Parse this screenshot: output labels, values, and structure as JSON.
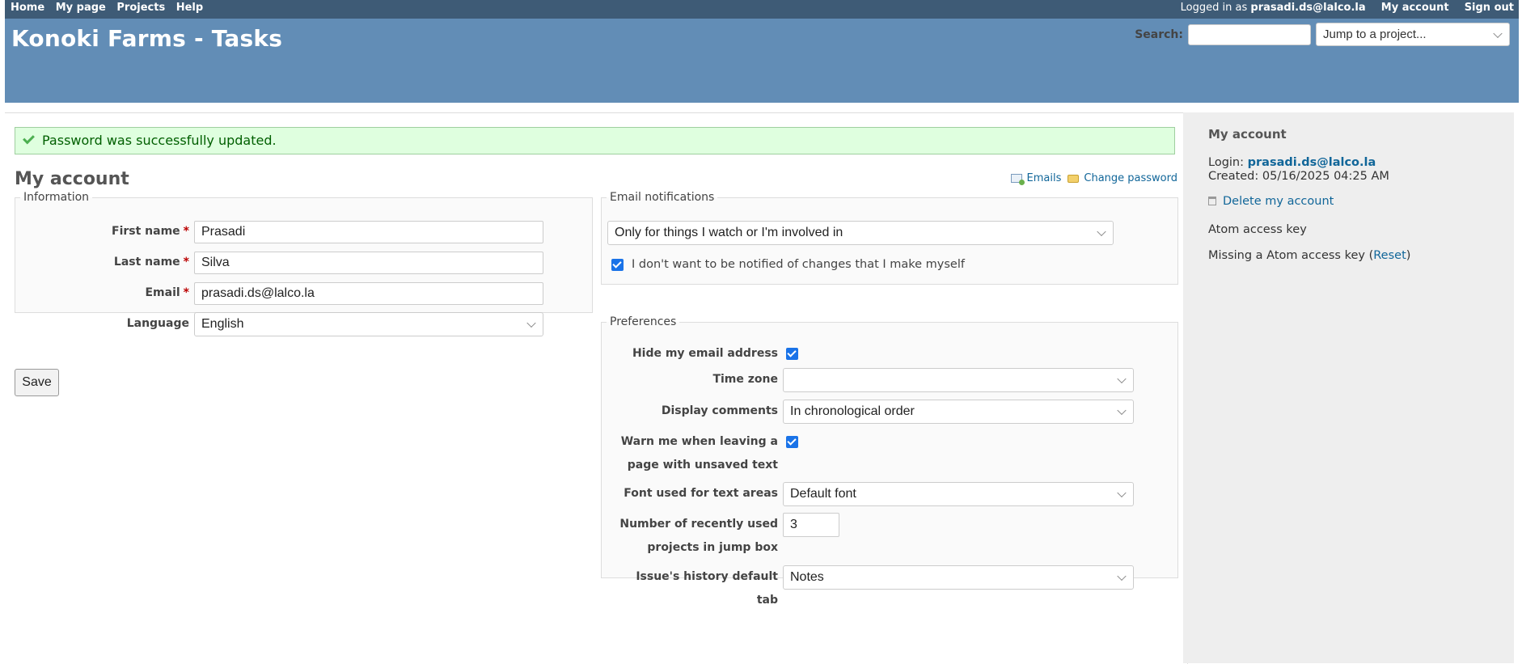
{
  "top_menu": {
    "home": "Home",
    "my_page": "My page",
    "projects": "Projects",
    "help": "Help",
    "logged_in_as": "Logged in as",
    "user": "prasadi.ds@lalco.la",
    "my_account": "My account",
    "sign_out": "Sign out"
  },
  "header": {
    "title": "Konoki Farms - Tasks",
    "search_label": "Search:",
    "search_value": "",
    "jump_placeholder": "Jump to a project..."
  },
  "flash": "Password was successfully updated.",
  "page_title": "My account",
  "context_links": {
    "emails": "Emails",
    "change_password": "Change password"
  },
  "information": {
    "legend": "Information",
    "first_name_label": "First name",
    "first_name": "Prasadi",
    "last_name_label": "Last name",
    "last_name": "Silva",
    "email_label": "Email",
    "email": "prasadi.ds@lalco.la",
    "language_label": "Language",
    "language": "English",
    "required_mark": "*"
  },
  "save_label": "Save",
  "email_notifications": {
    "legend": "Email notifications",
    "option": "Only for things I watch or I'm involved in",
    "no_self_notified": "I don't want to be notified of changes that I make myself",
    "no_self_notified_checked": true
  },
  "preferences": {
    "legend": "Preferences",
    "hide_email_label": "Hide my email address",
    "hide_email_checked": true,
    "time_zone_label": "Time zone",
    "time_zone": "",
    "display_comments_label": "Display comments",
    "display_comments": "In chronological order",
    "warn_label_1": "Warn me when leaving a",
    "warn_label_2": "page with unsaved text",
    "warn_checked": true,
    "font_label": "Font used for text areas",
    "font": "Default font",
    "recent_label_1": "Number of recently used",
    "recent_label_2": "projects in jump box",
    "recent": "3",
    "history_label_1": "Issue's history default",
    "history_label_2": "tab",
    "history": "Notes"
  },
  "sidebar": {
    "title": "My account",
    "login_label": "Login:",
    "login": "prasadi.ds@lalco.la",
    "created_label": "Created:",
    "created": "05/16/2025 04:25 AM",
    "delete": "Delete my account",
    "atom_title": "Atom access key",
    "atom_missing": "Missing a Atom access key (",
    "atom_reset": "Reset",
    "atom_close": ")"
  },
  "colors": {
    "top_menu": "#3e5b76",
    "header": "#628db6",
    "flash_bg": "#dfffdf",
    "link": "#116699"
  }
}
